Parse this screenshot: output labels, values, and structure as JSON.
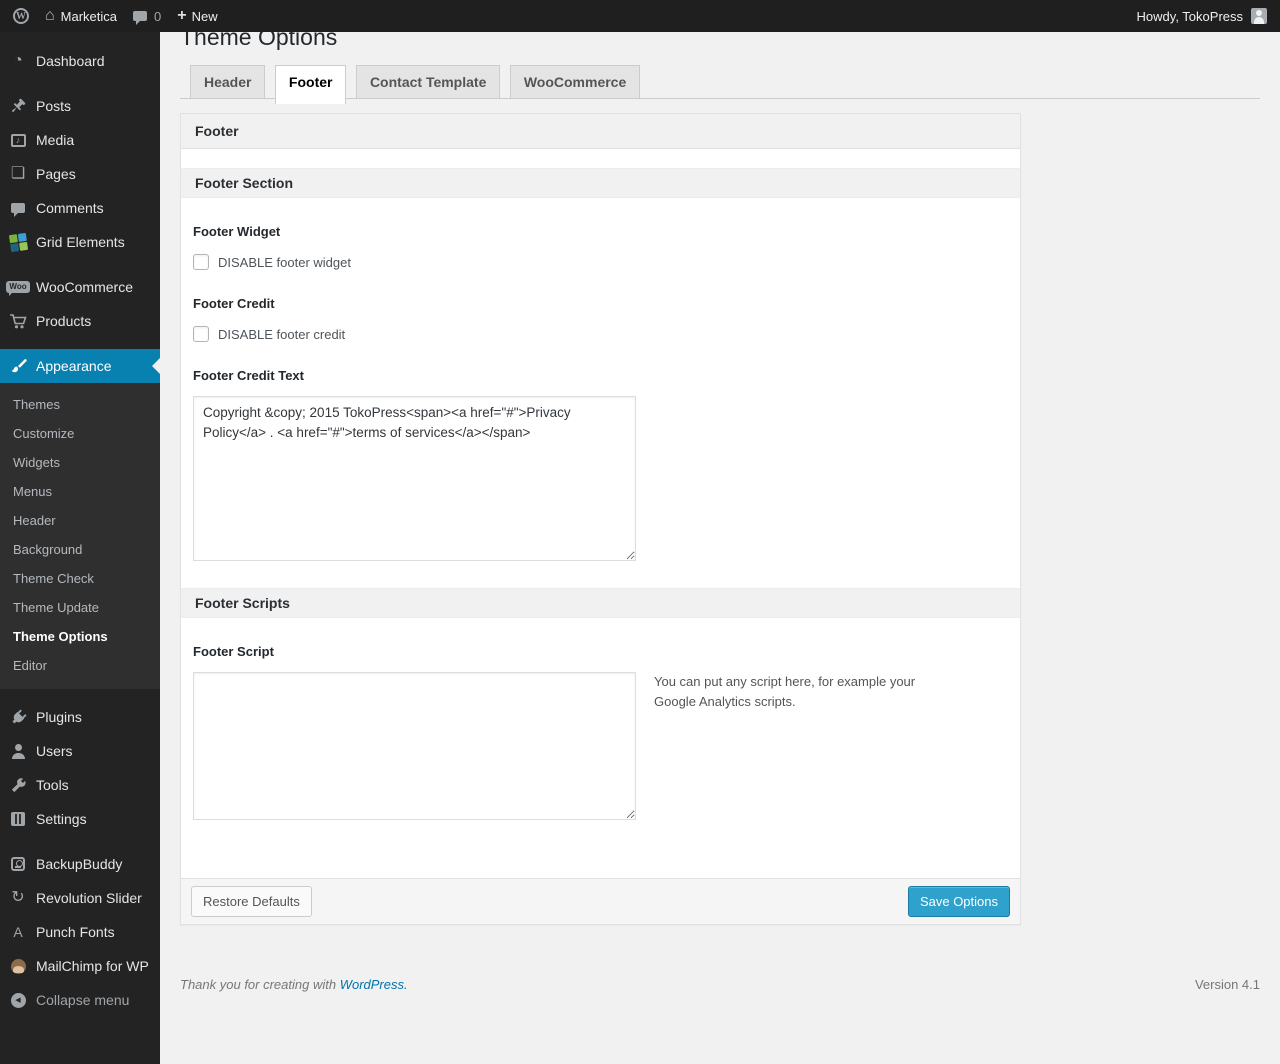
{
  "colors": {
    "accent": "#0880b0",
    "primary_button": "#2ea2cc",
    "link": "#0073aa"
  },
  "admin_bar": {
    "site_name": "Marketica",
    "comments_count": "0",
    "new_label": "New",
    "howdy": "Howdy, TokoPress"
  },
  "sidebar": {
    "woo_badge": "Woo",
    "punch_glyph": "A",
    "menu": [
      {
        "label": "Dashboard",
        "icon": "dashboard-icon"
      },
      {
        "label": "Posts",
        "icon": "pushpin-icon"
      },
      {
        "label": "Media",
        "icon": "media-icon"
      },
      {
        "label": "Pages",
        "icon": "pages-icon"
      },
      {
        "label": "Comments",
        "icon": "comment-bubble-icon"
      },
      {
        "label": "Grid Elements",
        "icon": "grid-elements-icon"
      },
      {
        "label": "WooCommerce",
        "icon": "woocommerce-badge-icon"
      },
      {
        "label": "Products",
        "icon": "cart-icon"
      },
      {
        "label": "Appearance",
        "icon": "paintbrush-icon",
        "active": true
      },
      {
        "label": "Plugins",
        "icon": "plug-icon"
      },
      {
        "label": "Users",
        "icon": "user-icon"
      },
      {
        "label": "Tools",
        "icon": "wrench-icon"
      },
      {
        "label": "Settings",
        "icon": "sliders-icon"
      },
      {
        "label": "BackupBuddy",
        "icon": "backup-drive-icon"
      },
      {
        "label": "Revolution Slider",
        "icon": "refresh-icon"
      },
      {
        "label": "Punch Fonts",
        "icon": "letter-a-icon"
      },
      {
        "label": "MailChimp for WP",
        "icon": "monkey-icon"
      },
      {
        "label": "Collapse menu",
        "icon": "collapse-arrow-icon"
      }
    ],
    "appearance_submenu": [
      "Themes",
      "Customize",
      "Widgets",
      "Menus",
      "Header",
      "Background",
      "Theme Check",
      "Theme Update",
      "Theme Options",
      "Editor"
    ],
    "current_submenu_item": "Theme Options"
  },
  "main": {
    "page_title": "Theme Options",
    "tabs": [
      {
        "label": "Header",
        "active": false
      },
      {
        "label": "Footer",
        "active": true
      },
      {
        "label": "Contact Template",
        "active": false
      },
      {
        "label": "WooCommerce",
        "active": false
      }
    ],
    "panel": {
      "header": "Footer",
      "section1": {
        "title": "Footer Section",
        "footer_widget": {
          "label": "Footer Widget",
          "checkbox_label": "DISABLE footer widget",
          "checked": false
        },
        "footer_credit": {
          "label": "Footer Credit",
          "checkbox_label": "DISABLE footer credit",
          "checked": false
        },
        "footer_credit_text": {
          "label": "Footer Credit Text",
          "value": "Copyright &copy; 2015 TokoPress<span><a href=\"#\">Privacy Policy</a> . <a href=\"#\">terms of services</a></span>"
        }
      },
      "section2": {
        "title": "Footer Scripts",
        "footer_script": {
          "label": "Footer Script",
          "value": "",
          "description": "You can put any script here, for example your Google Analytics scripts."
        }
      },
      "actions": {
        "restore_label": "Restore Defaults",
        "save_label": "Save Options"
      }
    },
    "page_footer": {
      "thanks_prefix": "Thank you for creating with",
      "wordpress_link": "WordPress.",
      "version": "Version 4.1"
    }
  }
}
